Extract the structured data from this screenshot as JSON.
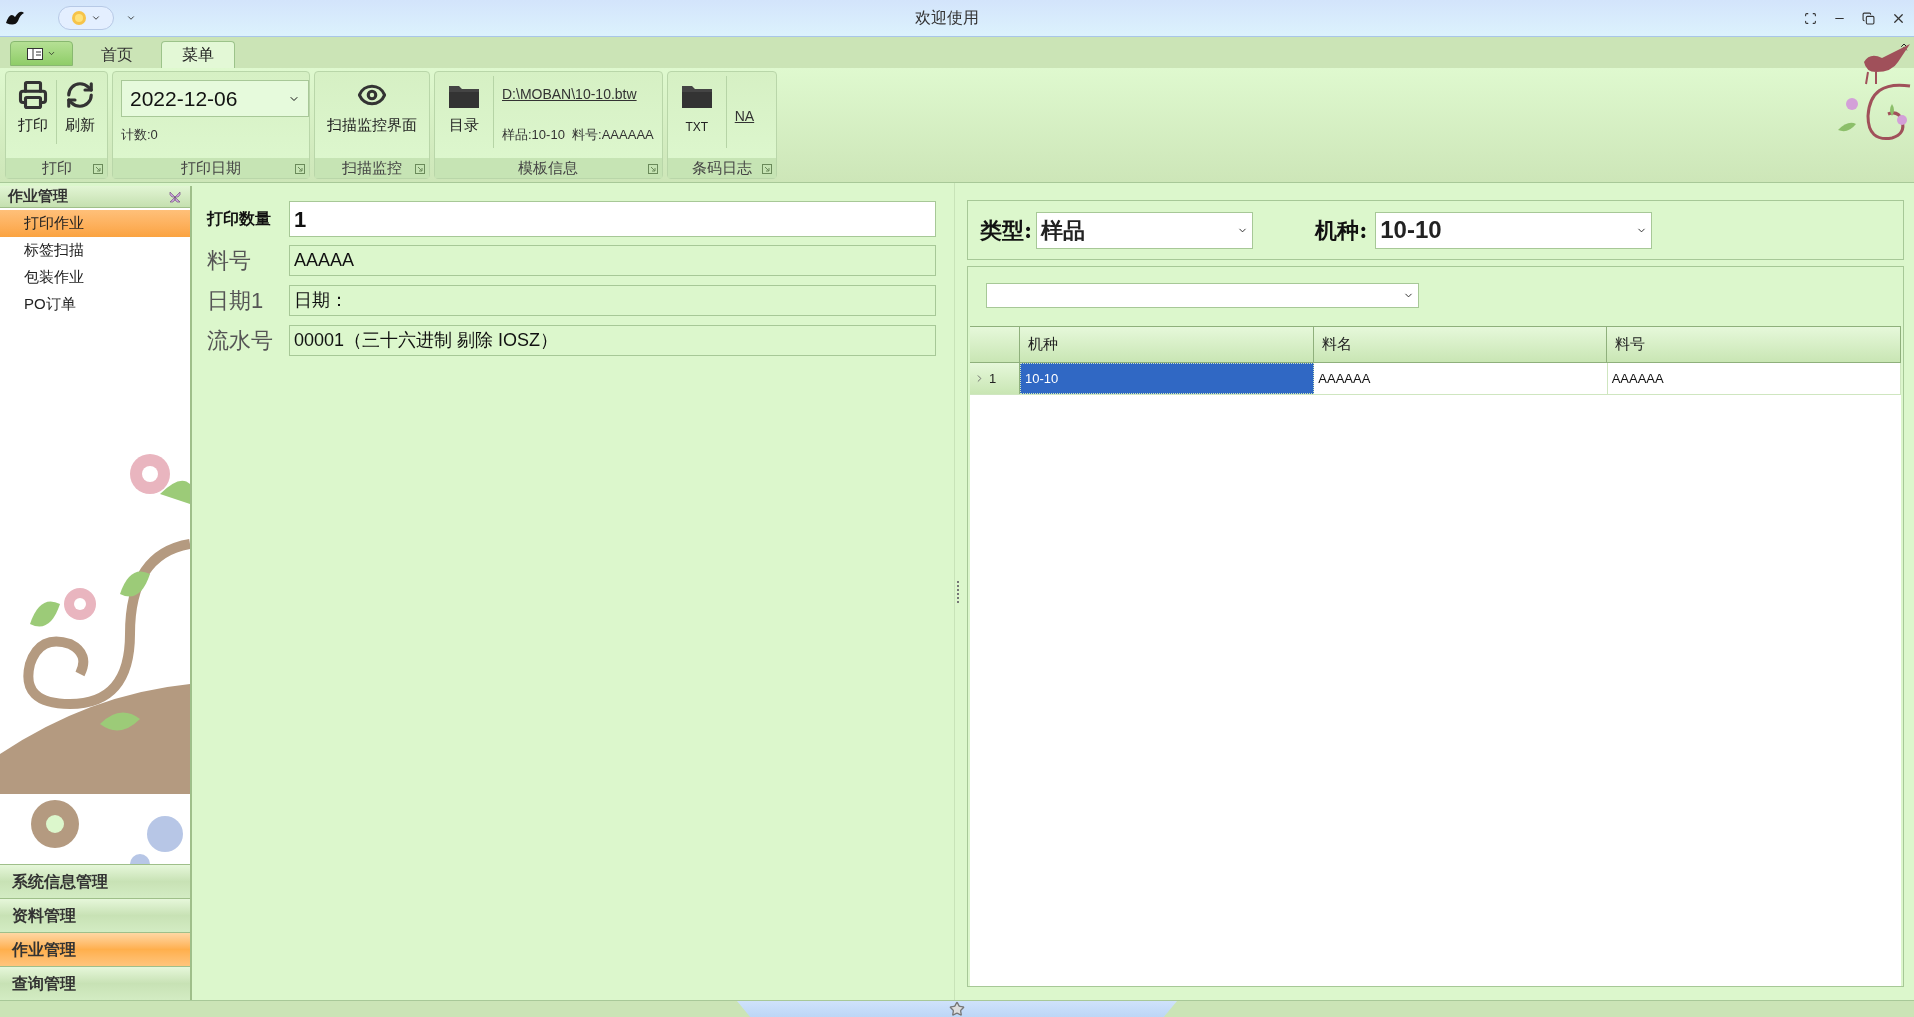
{
  "window": {
    "title": "欢迎使用"
  },
  "ribbon": {
    "tabs": [
      {
        "label": "首页",
        "selected": false
      },
      {
        "label": "菜单",
        "selected": true
      }
    ],
    "groups": [
      {
        "title": "打印",
        "items": [
          {
            "kind": "print",
            "label": "打印"
          },
          {
            "kind": "refresh",
            "label": "刷新"
          }
        ]
      },
      {
        "title": "打印日期",
        "items": [
          {
            "kind": "date",
            "value": "2022-12-06"
          },
          {
            "kind": "caption",
            "label": "计数:0"
          }
        ]
      },
      {
        "title": "扫描监控",
        "items": [
          {
            "kind": "eye",
            "label": "扫描监控界面"
          }
        ]
      },
      {
        "title": "模板信息",
        "items": [
          {
            "kind": "folder",
            "label": "目录"
          },
          {
            "kind": "link",
            "label": "D:\\MOBAN\\10-10.btw"
          },
          {
            "kind": "caption",
            "label": "样品:10-10  料号:AAAAAA"
          }
        ]
      },
      {
        "title": "条码日志",
        "items": [
          {
            "kind": "folder",
            "label": "TXT"
          },
          {
            "kind": "link",
            "label": "NA"
          }
        ]
      }
    ]
  },
  "sidebar": {
    "header": "作业管理",
    "items": [
      {
        "label": "打印作业",
        "selected": true
      },
      {
        "label": "标签扫描",
        "selected": false
      },
      {
        "label": "包装作业",
        "selected": false
      },
      {
        "label": "PO订单",
        "selected": false
      }
    ],
    "nav": [
      {
        "label": "系统信息管理",
        "selected": false
      },
      {
        "label": "资料管理",
        "selected": false
      },
      {
        "label": "作业管理",
        "selected": true
      },
      {
        "label": "查询管理",
        "selected": false
      }
    ]
  },
  "form": {
    "fields": [
      {
        "kind": "primary",
        "label": "打印数量",
        "value": "1"
      },
      {
        "kind": "readonly",
        "label": "料号",
        "value": "AAAAA"
      },
      {
        "kind": "readonly",
        "label": "日期1",
        "value": "日期："
      },
      {
        "kind": "readonly",
        "label": "流水号",
        "value": "00001（三十六进制 剔除 IOSZ）"
      }
    ]
  },
  "filter": {
    "type_label": "类型:",
    "type_value": "样品",
    "model_label": "机种:",
    "model_value": "10-10"
  },
  "grid": {
    "columns": [
      "机种",
      "料名",
      "料号"
    ],
    "rows": [
      {
        "number": "1",
        "selected": true,
        "cells": [
          "10-10",
          "AAAAAA",
          "AAAAAA"
        ]
      }
    ]
  }
}
